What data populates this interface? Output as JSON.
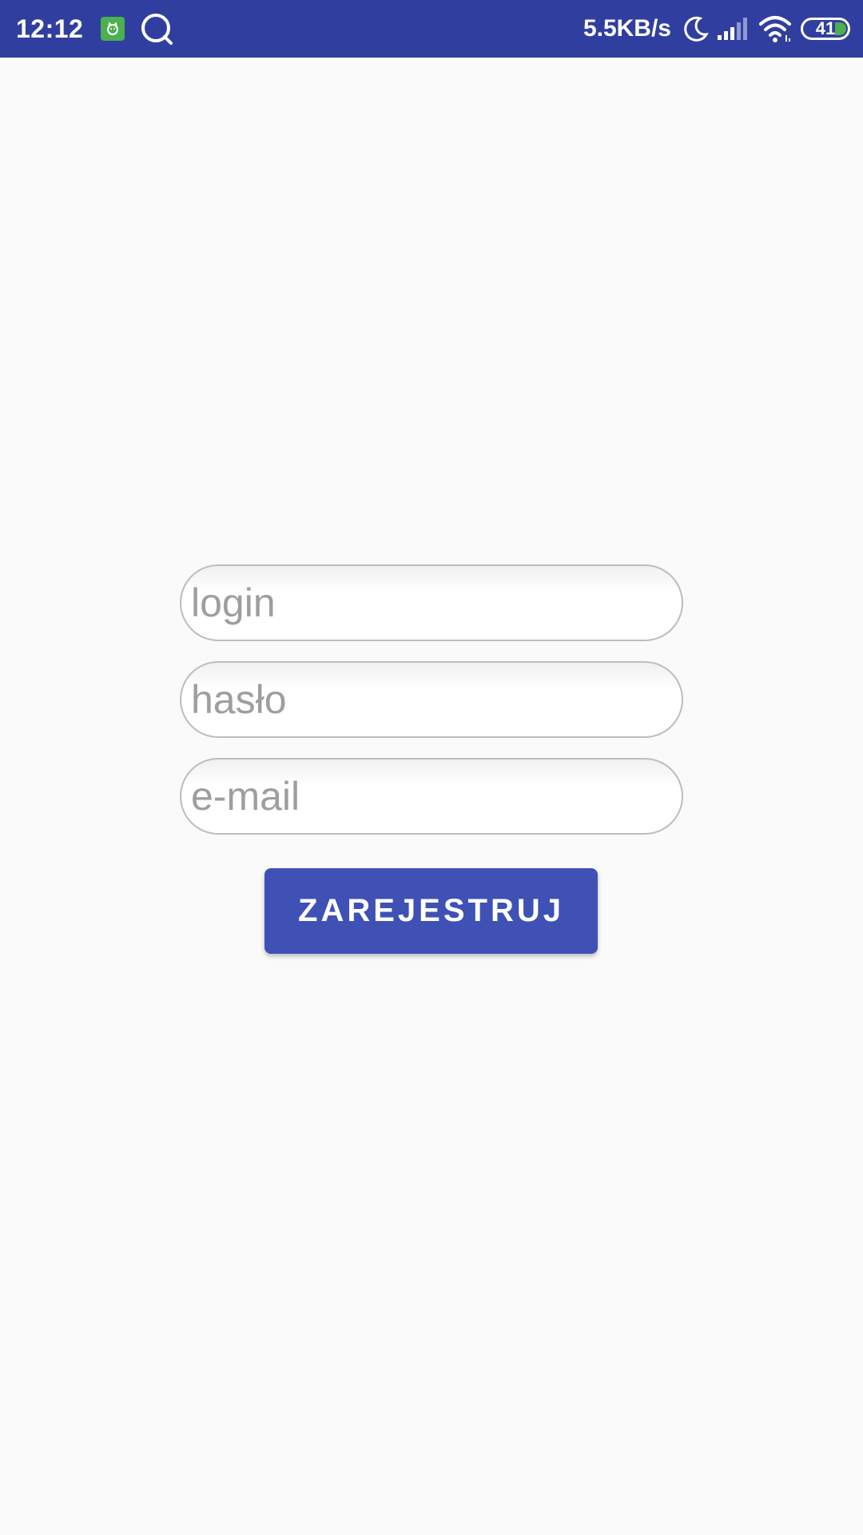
{
  "status_bar": {
    "time": "12:12",
    "network_speed": "5.5KB/s",
    "battery_level": "41",
    "icons": [
      "app-notification-icon",
      "search-icon",
      "moon-icon",
      "signal-icon",
      "wifi-icon",
      "battery-icon"
    ],
    "background_color": "#303f9f"
  },
  "form": {
    "login_placeholder": "login",
    "password_placeholder": "hasło",
    "email_placeholder": "e-mail",
    "login_value": "",
    "password_value": "",
    "email_value": ""
  },
  "register_button": {
    "label": "ZAREJESTRUJ",
    "color": "#3f51b5"
  }
}
